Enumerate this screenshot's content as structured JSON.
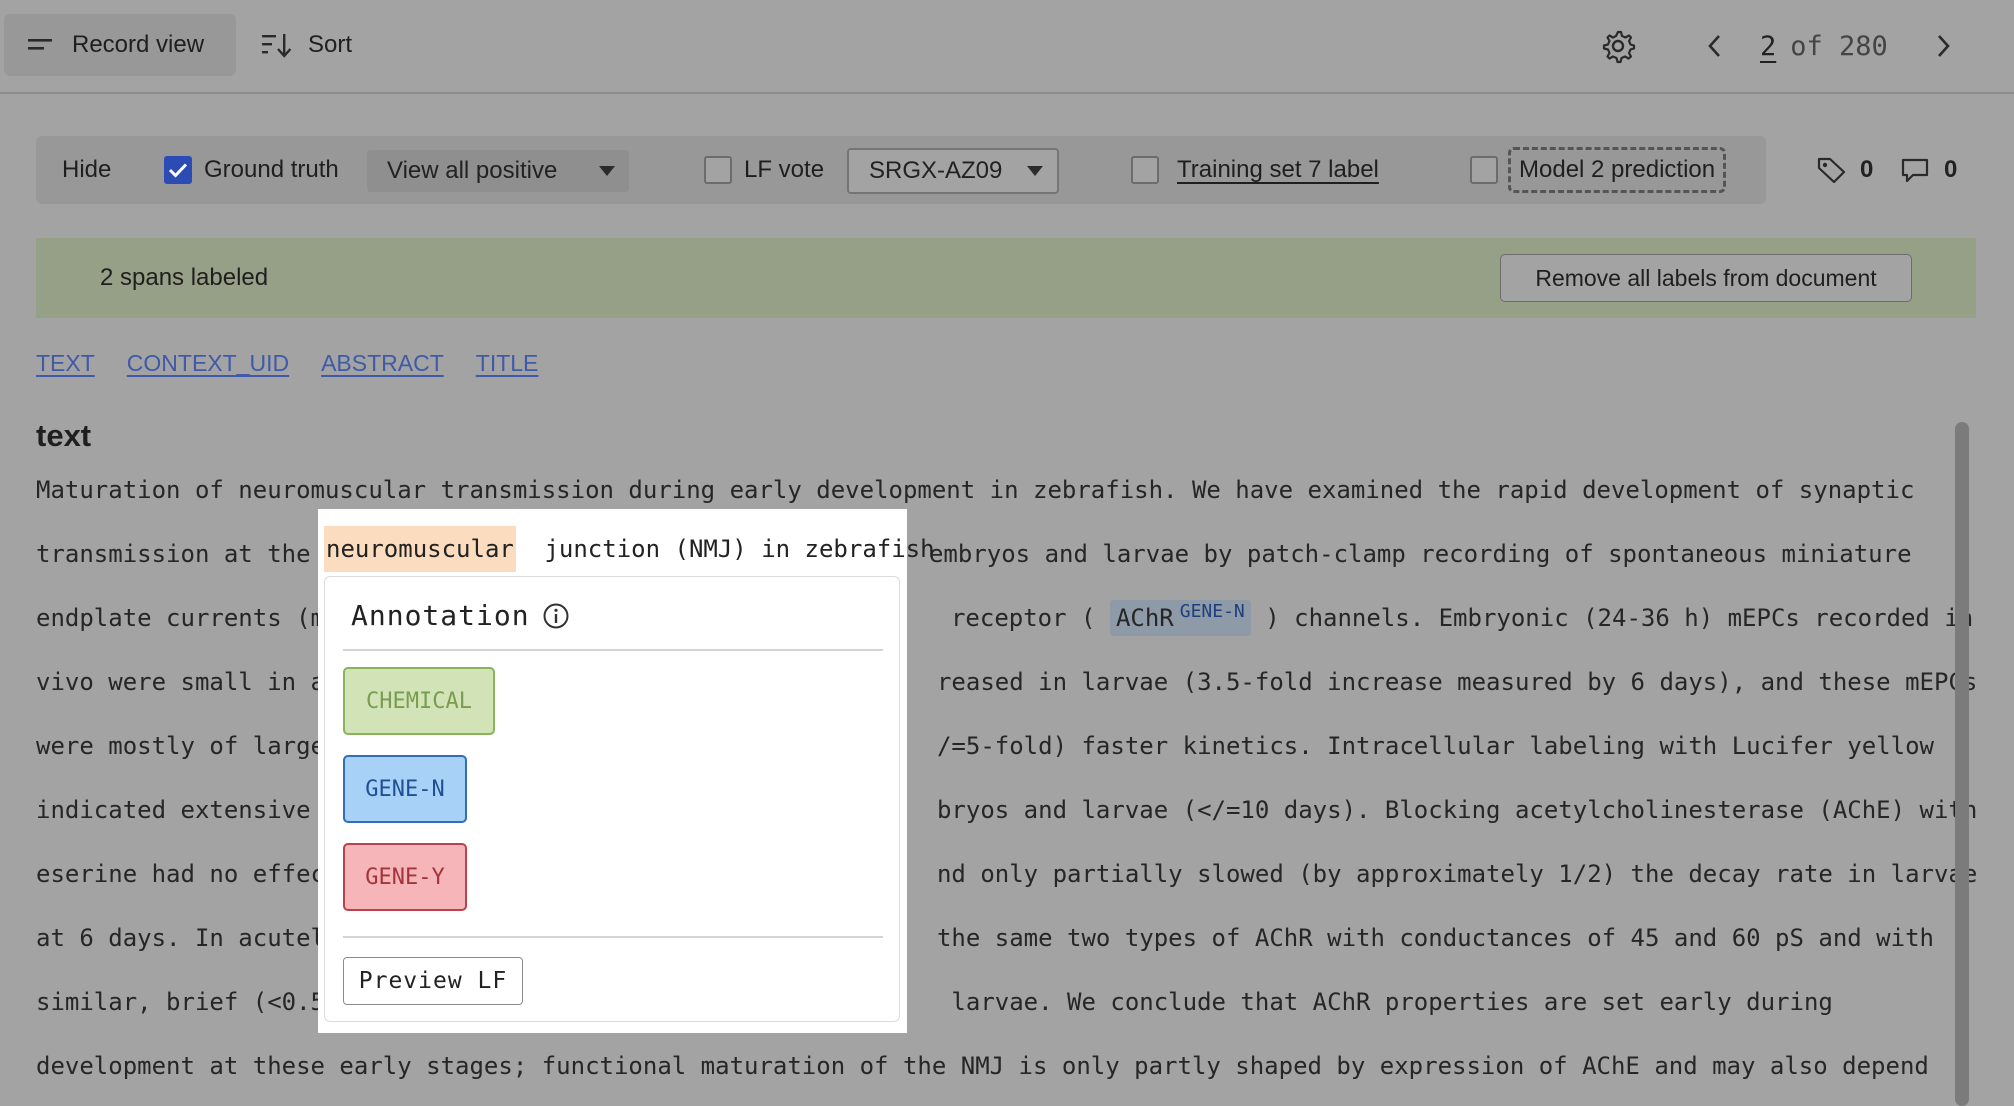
{
  "toolbar": {
    "record_view_label": "Record view",
    "sort_label": "Sort",
    "page_current": "2",
    "page_of": "of 280"
  },
  "filters": {
    "hide_label": "Hide",
    "ground_truth_label": "Ground truth",
    "ground_truth_checked": true,
    "ground_truth_select": "View all positive",
    "lf_vote_label": "LF vote",
    "lf_vote_checked": false,
    "lf_select": "SRGX-AZ09",
    "training_label": "Training set 7 label",
    "training_checked": false,
    "model_label": "Model 2 prediction",
    "model_checked": false,
    "tag_count": "0",
    "comment_count": "0"
  },
  "banner": {
    "text": "2 spans labeled",
    "remove_button": "Remove all labels from document",
    "color": "#95a086"
  },
  "tabs": [
    "TEXT",
    "CONTEXT_UID",
    "ABSTRACT",
    "TITLE"
  ],
  "section_title": "text",
  "document": {
    "line1": "Maturation of neuromuscular transmission during early development in zebrafish. We have examined the rapid development of synaptic",
    "line2_pre": "transmission at the ",
    "line2_post": "embryos and larvae by patch-clamp recording of spontaneous miniature",
    "line3_pre": "endplate currents (m",
    "line3_mid": "receptor ( ",
    "line3_span": "AChR",
    "line3_span_label": "GENE-N",
    "line3_post": " ) channels. Embryonic (24-36 h) mEPCs recorded in",
    "line4_pre": "vivo were small in a",
    "line4_post": "reased in larvae (3.5-fold increase measured by 6 days), and these mEPCs",
    "line5_pre": "were mostly of large",
    "line5_post": "/=5-fold) faster kinetics. Intracellular labeling with Lucifer yellow",
    "line6_pre": "indicated extensive ",
    "line6_post": "bryos and larvae (</=10 days). Blocking acetylcholinesterase (AChE) with",
    "line7_pre": "eserine had no effec",
    "line7_post": "nd only partially slowed (by approximately 1/2) the decay rate in larvae",
    "line8_pre": "at 6 days. In acutel",
    "line8_post": "the same two types of AChR with conductances of 45 and 60 pS and with",
    "line9_pre": "similar, brief (<0.5",
    "line9_post": " larvae. We conclude that AChR properties are set early during",
    "line10": "development at these early stages; functional maturation of the NMJ is only partly shaped by expression of AChE and may also depend"
  },
  "popup": {
    "selected_word": "neuromuscular",
    "following_text": " junction (NMJ) in zebrafish",
    "title": "Annotation",
    "labels": [
      {
        "name": "CHEMICAL",
        "color": "#d2e4b7"
      },
      {
        "name": "GENE-N",
        "color": "#a8d1f7"
      },
      {
        "name": "GENE-Y",
        "color": "#f6b5b8"
      }
    ],
    "preview_button": "Preview LF"
  }
}
